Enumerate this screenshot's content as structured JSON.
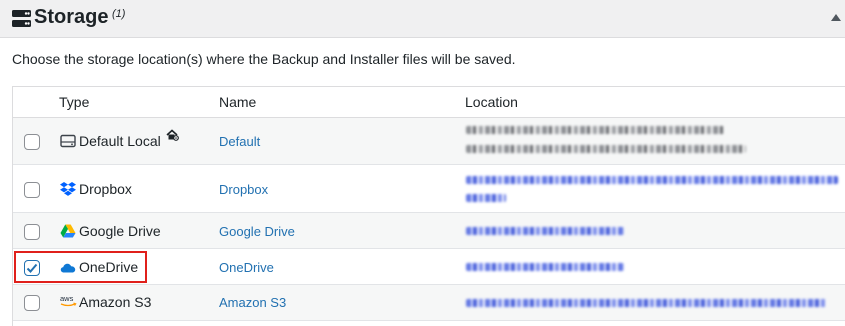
{
  "header": {
    "title": "Storage",
    "count": "(1)",
    "icon": "server-stack-icon",
    "collapse_icon": "caret-up-icon"
  },
  "description": "Choose the storage location(s) where the Backup and Installer files will be saved.",
  "table": {
    "columns": [
      "Type",
      "Name",
      "Location"
    ],
    "rows": [
      {
        "checked": false,
        "type_icon": "hard-drive-icon",
        "type": "Default Local",
        "badge_icon": "home-gear-icon",
        "name": "Default"
      },
      {
        "checked": false,
        "type_icon": "dropbox-icon",
        "type": "Dropbox",
        "name": "Dropbox"
      },
      {
        "checked": false,
        "type_icon": "google-drive-icon",
        "type": "Google Drive",
        "name": "Google Drive"
      },
      {
        "checked": true,
        "type_icon": "onedrive-icon",
        "type": "OneDrive",
        "name": "OneDrive"
      },
      {
        "checked": false,
        "type_icon": "aws-icon",
        "type": "Amazon S3",
        "name": "Amazon S3"
      }
    ]
  },
  "colors": {
    "accent": "#2271b1",
    "highlight": "#e0201b",
    "header_bg": "#f0f0f1"
  }
}
